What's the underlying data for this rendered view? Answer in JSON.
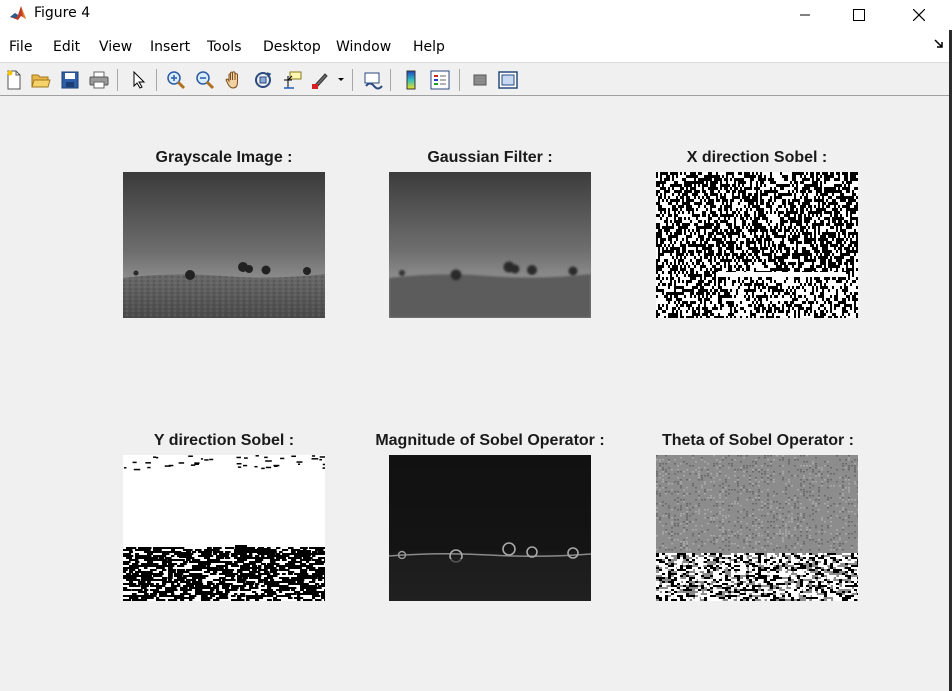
{
  "window": {
    "title": "Figure 4"
  },
  "menu": {
    "items": [
      "File",
      "Edit",
      "View",
      "Insert",
      "Tools",
      "Desktop",
      "Window",
      "Help"
    ]
  },
  "toolbar": {
    "icons": [
      "new-figure-icon",
      "open-file-icon",
      "save-icon",
      "print-icon",
      "select-arrow-icon",
      "zoom-in-icon",
      "zoom-out-icon",
      "pan-hand-icon",
      "rotate-3d-icon",
      "data-cursor-icon",
      "brush-icon",
      "link-plot-icon",
      "colorbar-icon",
      "legend-icon",
      "hide-plot-tools-icon",
      "show-plot-tools-icon"
    ]
  },
  "plots": [
    {
      "title": "Grayscale Image :",
      "kind": "grayscale"
    },
    {
      "title": "Gaussian Filter :",
      "kind": "gaussian"
    },
    {
      "title": "X direction Sobel :",
      "kind": "sobel-x"
    },
    {
      "title": "Y direction Sobel :",
      "kind": "sobel-y"
    },
    {
      "title": "Magnitude of Sobel Operator :",
      "kind": "magnitude"
    },
    {
      "title": "Theta of Sobel Operator :",
      "kind": "theta"
    }
  ],
  "colors": {
    "titlebar": "#ffffff",
    "figure_background": "#f0f0f0",
    "title_text": "#1a1a1a"
  }
}
